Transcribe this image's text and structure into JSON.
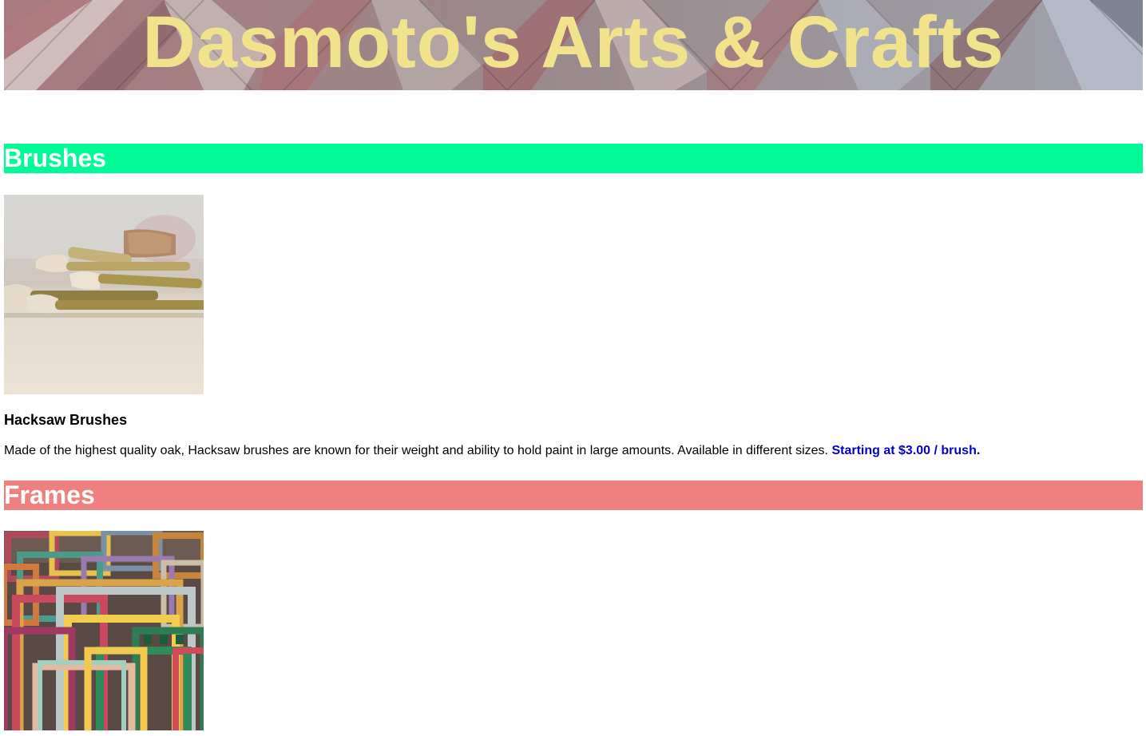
{
  "banner": {
    "title": "Dasmoto's Arts & Crafts"
  },
  "sections": {
    "brushes": {
      "heading": "Brushes",
      "color": "#00fa96",
      "image_alt": "paint brushes",
      "product": {
        "title": "Hacksaw Brushes",
        "description": "Made of the highest quality oak, Hacksaw brushes are known for their weight and ability to hold paint in large amounts. Available in different sizes.",
        "price": "Starting at $3.00 / brush",
        "price_suffix": "."
      }
    },
    "frames": {
      "heading": "Frames",
      "color": "#f08080",
      "image_alt": "picture frames"
    }
  },
  "colors": {
    "banner_text": "#f0e38b",
    "price_text": "#0000cd"
  }
}
